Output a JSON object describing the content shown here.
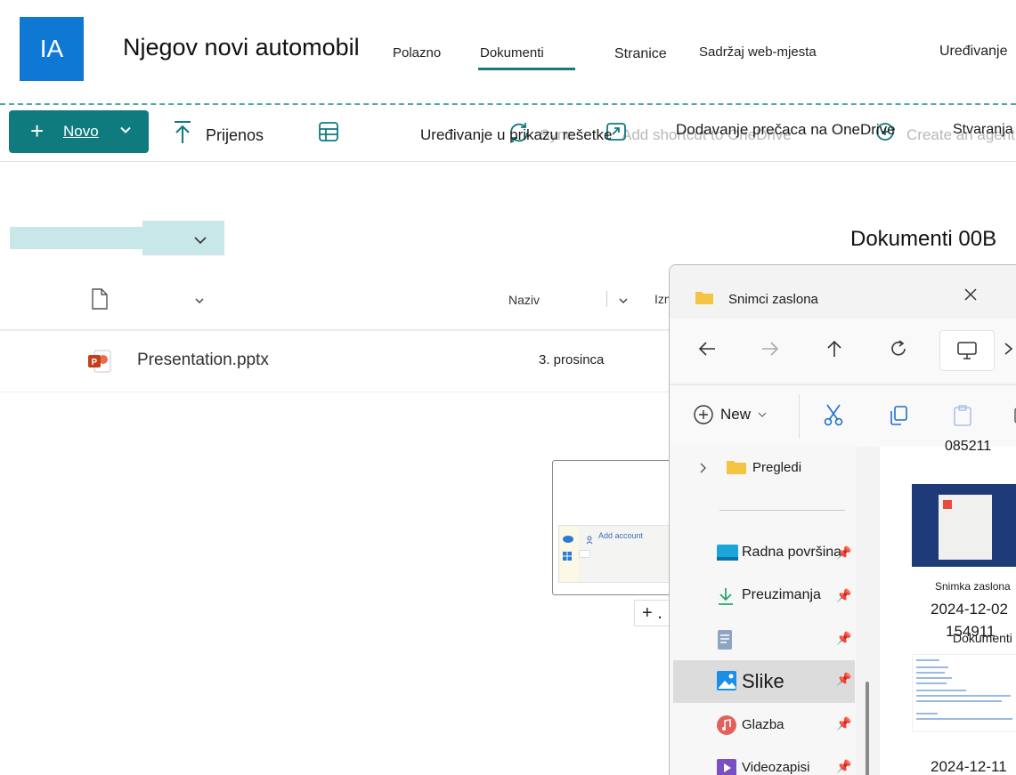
{
  "site": {
    "logo_initials": "IA",
    "title": "Njegov novi automobil",
    "nav": [
      "Polazno",
      "Dokumenti",
      "Stranice",
      "Sadržaj web-mjesta",
      "Uređivanje"
    ],
    "active_nav": "Dokumenti"
  },
  "commandbar": {
    "new_label": "Novo",
    "upload_label": "Prijenos",
    "grid_edit_label": "Uređivanje u prikazu rešetke",
    "shortcut_label": "Dodavanje prečaca na OneDrive",
    "create_label": "Stvaranja",
    "sync_overlay": "Sync",
    "ghost_shortcut": "Add shortcut to OneDrive",
    "ghost_create": "Create an agent"
  },
  "library": {
    "title": "Dokumenti 00B",
    "columns": {
      "name": "Naziv",
      "modified": "Izmijenjeno"
    },
    "files": [
      {
        "name": "Presentation.pptx",
        "modified": "3. prosinca",
        "type": "pptx"
      }
    ]
  },
  "drag": {
    "preview_text": "Add account",
    "copy_badge": "+ ."
  },
  "explorer": {
    "tab_title": "Snimci zaslona",
    "toolbar": {
      "new_label": "New"
    },
    "sidebar": [
      {
        "label": "Pregledi",
        "icon": "folder-icon",
        "pinned": false
      },
      {
        "label": "Radna površina",
        "icon": "desktop-icon",
        "pinned": true
      },
      {
        "label": "Preuzimanja",
        "icon": "download-icon",
        "pinned": true
      },
      {
        "label": "",
        "icon": "documents-icon",
        "pinned": true
      },
      {
        "label": "Slike",
        "icon": "pictures-icon",
        "pinned": true,
        "active": true
      },
      {
        "label": "Glazba",
        "icon": "music-icon",
        "pinned": true
      },
      {
        "label": "Videozapisi",
        "icon": "video-icon",
        "pinned": true
      }
    ],
    "content": {
      "top_partial": "085211",
      "items": [
        {
          "label": "Snimka zaslona",
          "line2": "2024-12-02",
          "line3": "154911"
        },
        {
          "label": "",
          "line2": "2024-12-11",
          "line3": ""
        }
      ],
      "overlap_text": "Dokumenti"
    }
  },
  "colors": {
    "accent": "#0f7b7f",
    "logo": "#0f78d4",
    "view_highlight": "#c7e7e8"
  }
}
